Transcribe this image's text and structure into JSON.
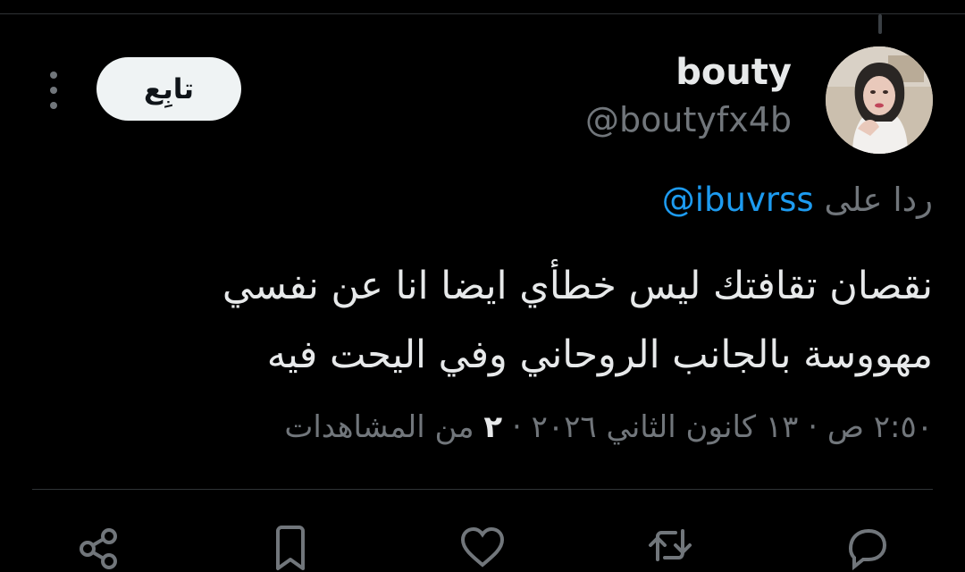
{
  "tweet": {
    "author": {
      "display_name": "bouty",
      "handle": "@boutyfx4b",
      "avatar_icon": "profile-photo"
    },
    "follow_label": "تابِع",
    "more_icon": "more-vertical-icon",
    "reply_prefix": "ردا على",
    "reply_mention": "@ibuvrss",
    "text_lines": [
      "نقصان تقافتك ليس خطأي ايضا انا عن نفسي",
      "مهووسة بالجانب الروحاني وفي اليحت فيه"
    ],
    "timestamp": "٢:٥٠ ص · ١٣ كانون الثاني ٢٠٢٦",
    "separator": "·",
    "views_count": "٢",
    "views_label": "من المشاهدات"
  },
  "actions": [
    {
      "icon": "reply-icon"
    },
    {
      "icon": "retweet-icon"
    },
    {
      "icon": "like-icon"
    },
    {
      "icon": "bookmark-icon"
    },
    {
      "icon": "share-icon"
    }
  ],
  "colors": {
    "background": "#000000",
    "text": "#e7e9ea",
    "secondary": "#71767b",
    "link": "#1d9bf0",
    "follow_bg": "#eff3f4"
  }
}
